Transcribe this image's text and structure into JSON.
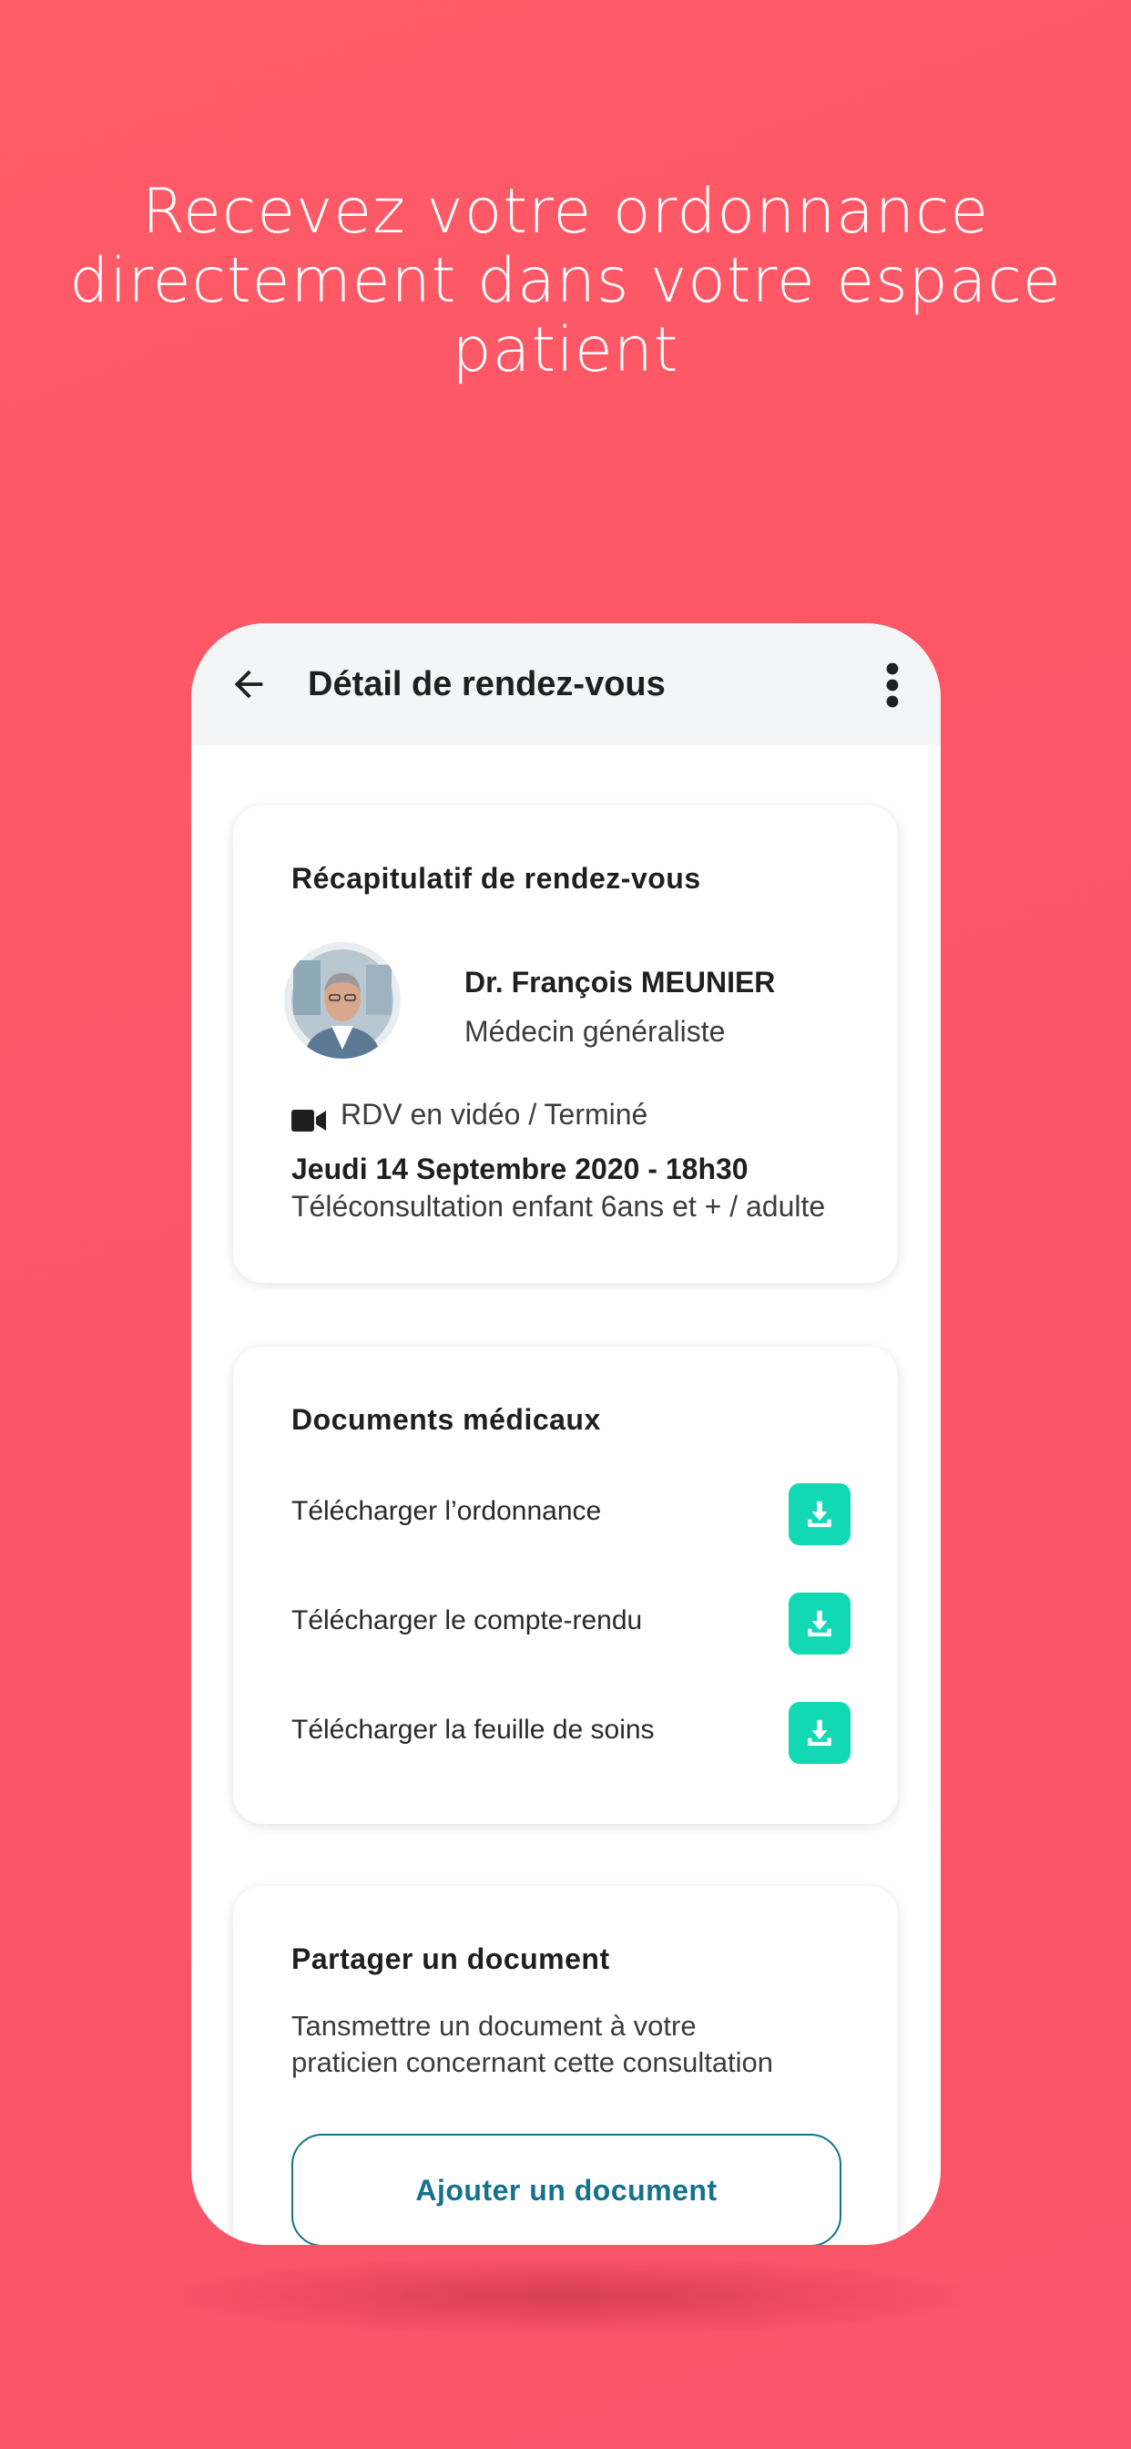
{
  "headline": {
    "line1": "Recevez votre ordonnance",
    "line2": "directement dans votre espace",
    "line3": "patient"
  },
  "appbar": {
    "title": "Détail de rendez-vous",
    "back_icon": "arrow-left-icon",
    "more_icon": "more-vertical-icon"
  },
  "summary": {
    "title": "Récapitulatif de rendez-vous",
    "doctor_name": "Dr. François MEUNIER",
    "doctor_specialty": "Médecin généraliste",
    "status": "RDV en vidéo / Terminé",
    "date": "Jeudi 14 Septembre 2020 - 18h30",
    "consult_type": "Téléconsultation enfant 6ans et + / adulte"
  },
  "documents": {
    "title": "Documents médicaux",
    "items": [
      {
        "label": "Télécharger l’ordonnance"
      },
      {
        "label": "Télécharger le compte-rendu"
      },
      {
        "label": "Télécharger la feuille de soins"
      }
    ]
  },
  "share": {
    "title": "Partager un document",
    "desc_line1": "Tansmettre un document à votre",
    "desc_line2": "praticien concernant cette consultation",
    "button": "Ajouter un document"
  },
  "colors": {
    "background": "#fc5566",
    "accent_download": "#12d9b4",
    "button_outline": "#14728f"
  }
}
